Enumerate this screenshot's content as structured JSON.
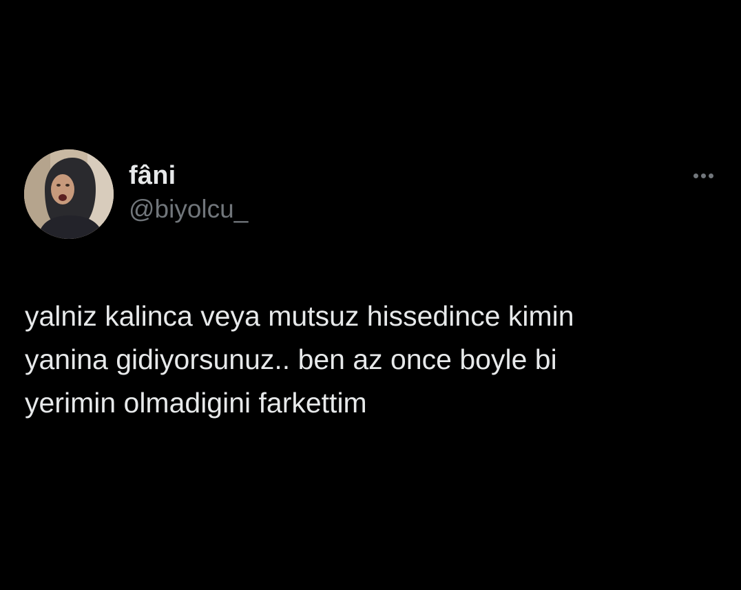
{
  "tweet": {
    "author": {
      "display_name": "fâni",
      "handle": "@biyolcu_",
      "avatar_icon": "profile-photo"
    },
    "more_icon": "more-horizontal-icon",
    "text": "yalniz kalinca veya mutsuz hissedince kimin\nyanina gidiyorsunuz.. ben az once boyle bi\nyerimin olmadigini farkettim"
  },
  "colors": {
    "background": "#000000",
    "primary_text": "#e7e9ea",
    "secondary_text": "#71767b"
  }
}
